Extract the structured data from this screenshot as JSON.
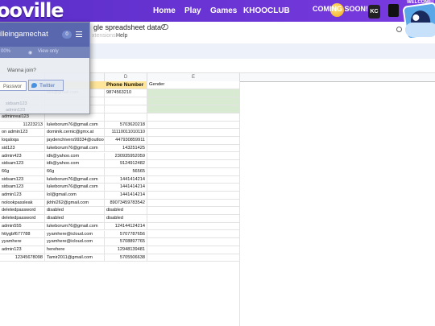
{
  "site": {
    "logo": "ooville",
    "nav": [
      "Home",
      "Play",
      "Games",
      "KHOOCLUB"
    ],
    "coming_soon": "COMING SOON!",
    "kc_badge": "KC",
    "welcome": "WELCOME!",
    "brand_color": "#6d35d6"
  },
  "sheet": {
    "title_partial": "gle spreadsheet data?",
    "menu": [
      "xtensions",
      "Help"
    ]
  },
  "grid": {
    "col_headers": [
      "",
      "",
      "",
      "D",
      "E"
    ],
    "header_row": {
      "phone": "Phone Number",
      "gender": "Gender"
    },
    "row1": {
      "b": "sss@gmail.com",
      "d": "9874563210"
    },
    "rows": [
      {
        "a": "adminreal123",
        "b": "",
        "d": ""
      },
      {
        "a": "11223213",
        "b": "lukeborum76@gmail.com",
        "d": "5703620218"
      },
      {
        "a": "on admin123",
        "b": "dominik.cernic@gmx.at",
        "d": "11110011010110"
      },
      {
        "a": "loqaloqa",
        "b": "jaydenchivers99334@outlool",
        "d": "447930859911"
      },
      {
        "a": "sid123",
        "b": "lukeborum76@gmail.com",
        "d": "143251425"
      },
      {
        "a": "admin423",
        "b": "idk@yahoo.com",
        "d": "230935952059"
      },
      {
        "a": "sidsam123",
        "b": "idk@yahoo.com",
        "d": "9124912482"
      },
      {
        "a": "66g",
        "b": "66g",
        "d": "56565"
      },
      {
        "a": "sidsam123",
        "b": "lukeborum76@gmail.com",
        "d": "1441414214"
      },
      {
        "a": "sidsam123",
        "b": "lukeborum76@gmail.com",
        "d": "1441414214"
      },
      {
        "a": "admin123",
        "b": "lol@gmail.com",
        "d": "1441414214"
      },
      {
        "a": "nolookpassleak",
        "b": "jkhhi262@gmail.com",
        "d": "89073459783542"
      },
      {
        "a": "deletedpassword",
        "b": "disabled",
        "d": "disabled"
      },
      {
        "a": "deletedpassword",
        "b": "disabled",
        "d": "disabled"
      },
      {
        "a": "admin555",
        "b": "lukeborum76@gmail.com",
        "d": "124144124214"
      },
      {
        "a": "httygbf677788",
        "b": "yyamhere@icloud.com",
        "d": "5707787656"
      },
      {
        "a": "yyamhere",
        "b": "yyamhere@icloud.com",
        "d": "5708897765"
      },
      {
        "a": "admin123",
        "b": "herehere",
        "d": "12948139481"
      },
      {
        "a": "12345678098",
        "b": "Tamir2011@gmail.com",
        "d": "5705506638"
      }
    ]
  },
  "panel": {
    "title": "illeingamechat",
    "badge": "0",
    "sub_left": "00%",
    "sub_right": "View only",
    "wanna_join": "Wanna join?",
    "password_btn": "Passwor",
    "twitter_btn": "Twitter",
    "ghost_lines": [
      "sidsam123",
      "admin123"
    ]
  }
}
